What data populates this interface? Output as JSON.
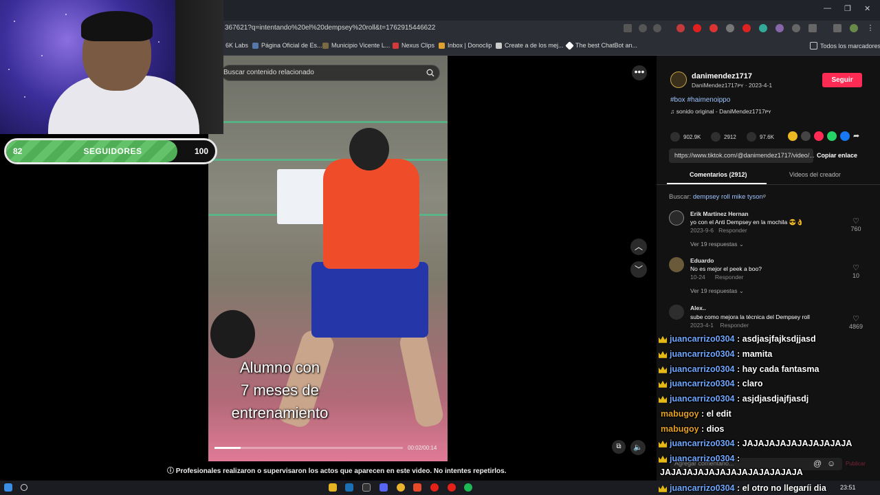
{
  "browser": {
    "url": "367621?q=intentando%20el%20dempsey%20roll&t=1762915446622",
    "bookmarks": [
      {
        "label": "6K Labs",
        "color": "#3a3a3a"
      },
      {
        "label": "Página Oficial de Es...",
        "color": "#5577aa"
      },
      {
        "label": "Municipio Vicente L...",
        "color": "#7a6a44"
      },
      {
        "label": "Nexus Clips",
        "color": "#d43a3a"
      },
      {
        "label": "Inbox | Donoclip",
        "color": "#e0a030"
      },
      {
        "label": "Create a de los mej...",
        "color": "#cccccc"
      },
      {
        "label": "The best ChatBot an...",
        "color": "#ffffff"
      }
    ],
    "all_bookmarks": "Todos los marcadores"
  },
  "stream": {
    "follower_goal": {
      "label": "SEGUIDORES",
      "current": "82",
      "goal": "100",
      "progress": 0.82,
      "accent": "#64c26a"
    }
  },
  "video": {
    "search_placeholder": "Buscar contenido relacionado",
    "caption_lines": [
      "Alumno con",
      "7 meses de",
      "entrenamiento"
    ],
    "time": "00:02/00:14",
    "progress": 0.14,
    "warning": "Profesionales realizaron o supervisaron los actos que aparecen en este video. No intentes repetirlos."
  },
  "post": {
    "username": "danimendez1717",
    "subtitle": "DaniMendez1717ᴘʏ · 2023-4-1",
    "follow_label": "Seguir",
    "hashtags": "#box #haimenoippo",
    "sound": "sonido original - DaniMendez1717ᴘʏ",
    "likes": "902.9K",
    "comments": "2912",
    "saves": "97.6K",
    "link": "https://www.tiktok.com/@danimendez1717/video/...",
    "copy_label": "Copiar enlace",
    "tab_comments": "Comentarios (2912)",
    "tab_videos": "Videos del creador",
    "search_prefix": "Buscar:",
    "search_term": "dempsey roll mike tyson"
  },
  "comments": [
    {
      "name": "Erik Martinez Hernan",
      "text": "yo con el Anti Dempsey en la mochila 😎👌",
      "date": "2023-9-6",
      "reply": "Responder",
      "replies": "Ver 19 respuestas ⌄",
      "likes": "760"
    },
    {
      "name": "Eduardo",
      "text": "No es mejor el peek a boo?",
      "date": "10-24",
      "reply": "Responder",
      "replies": "Ver 19 respuestas ⌄",
      "likes": "10"
    },
    {
      "name": "Alex..",
      "text": "sube como mejora la técnica del Dempsey roll",
      "date": "2023-4-1",
      "reply": "Responder",
      "replies": "",
      "likes": "4869"
    }
  ],
  "chat": [
    {
      "name": "juancarrizo0304",
      "msg": ": asdjasjfajksdjjasd",
      "color": "blue"
    },
    {
      "name": "juancarrizo0304",
      "msg": ": mamita",
      "color": "blue"
    },
    {
      "name": "juancarrizo0304",
      "msg": ": hay cada fantasma",
      "color": "blue"
    },
    {
      "name": "juancarrizo0304",
      "msg": ": claro",
      "color": "blue"
    },
    {
      "name": "juancarrizo0304",
      "msg": ": asjdjasdjajfjasdj",
      "color": "blue"
    },
    {
      "name": "mabugoy",
      "msg": ": el edit",
      "color": "orange"
    },
    {
      "name": "mabugoy",
      "msg": ": dios",
      "color": "orange"
    },
    {
      "name": "juancarrizo0304",
      "msg": ": JAJAJAJAJAJAJAJAJAJA",
      "color": "blue"
    },
    {
      "name": "juancarrizo0304",
      "msg": ":",
      "color": "blue"
    },
    {
      "name": "",
      "msg": "JAJAJAJAJAJAJAJAJAJAJAJAJA",
      "color": "none"
    },
    {
      "name": "juancarrizo0304",
      "msg": ": el otro no llegaríi dia",
      "color": "blue"
    }
  ],
  "comment_box": {
    "placeholder": "Agregar comentario...",
    "post_label": "Publicar"
  },
  "taskbar": {
    "time": "23:51"
  }
}
